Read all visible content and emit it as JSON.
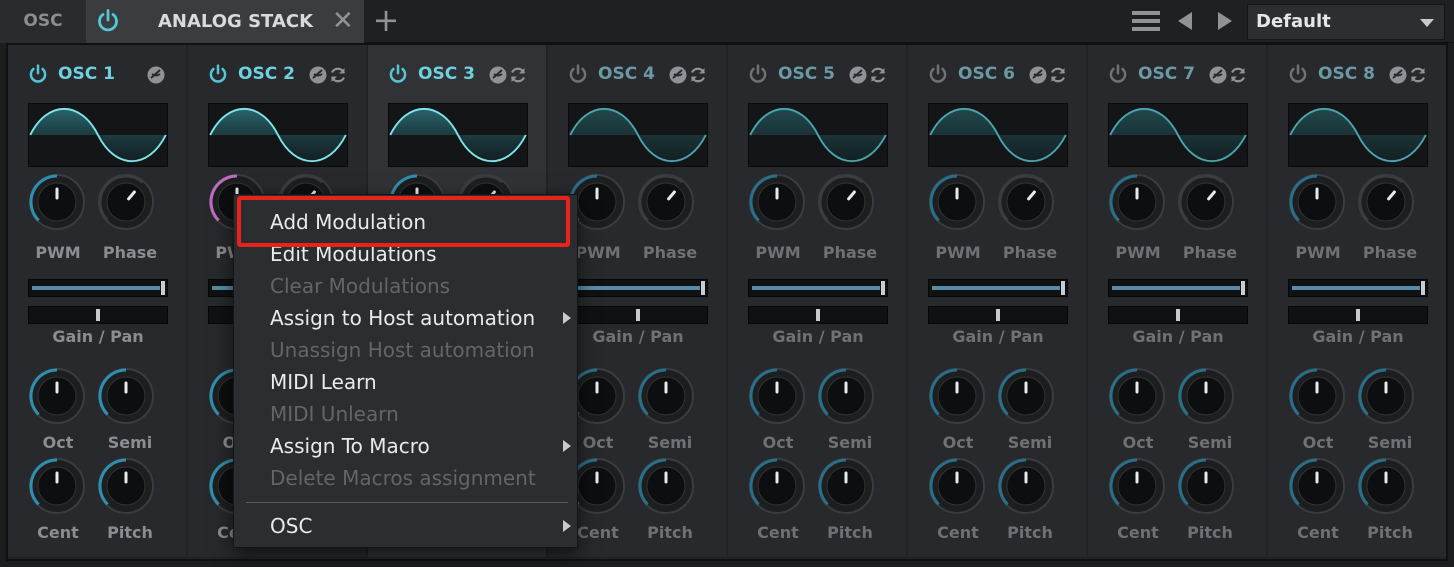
{
  "topbar": {
    "section_tab": "OSC",
    "module_tab": "ANALOG STACK",
    "close_label": "✕",
    "add_label": "+",
    "preset": "Default"
  },
  "colors": {
    "accent": "#55c7d4",
    "active_header": "#6fd1de",
    "inactive_header": "#6b9aa4",
    "highlight": "#e8231c",
    "mod_ring": "#c06cc0"
  },
  "oscillators": [
    {
      "name": "OSC 1",
      "active": true
    },
    {
      "name": "OSC 2",
      "active": true
    },
    {
      "name": "OSC 3",
      "active": true
    },
    {
      "name": "OSC 4",
      "active": false
    },
    {
      "name": "OSC 5",
      "active": false
    },
    {
      "name": "OSC 6",
      "active": false
    },
    {
      "name": "OSC 7",
      "active": false
    },
    {
      "name": "OSC 8",
      "active": false
    }
  ],
  "labels": {
    "pwm": "PWM",
    "phase": "Phase",
    "gain_pan": "Gain / Pan",
    "oct": "Oct",
    "semi": "Semi",
    "cent": "Cent",
    "pitch": "Pitch"
  },
  "context_menu": {
    "items": [
      {
        "label": "Add Modulation",
        "enabled": true,
        "submenu": false
      },
      {
        "label": "Edit Modulations",
        "enabled": true,
        "submenu": false
      },
      {
        "label": "Clear Modulations",
        "enabled": false,
        "submenu": false
      },
      {
        "label": "Assign to Host automation",
        "enabled": true,
        "submenu": true
      },
      {
        "label": "Unassign Host automation",
        "enabled": false,
        "submenu": false
      },
      {
        "label": "MIDI Learn",
        "enabled": true,
        "submenu": false
      },
      {
        "label": "MIDI Unlearn",
        "enabled": false,
        "submenu": false
      },
      {
        "label": "Assign To Macro",
        "enabled": true,
        "submenu": true
      },
      {
        "label": "Delete Macros assignment",
        "enabled": false,
        "submenu": false
      },
      {
        "label": "OSC",
        "enabled": true,
        "submenu": true
      }
    ]
  },
  "icons": {
    "power": "power-icon",
    "mod": "modulation-icon",
    "sync": "sync-icon",
    "menu": "hamburger-icon",
    "prev": "arrow-left-icon",
    "next": "arrow-right-icon",
    "dropdown": "chevron-down-icon"
  }
}
